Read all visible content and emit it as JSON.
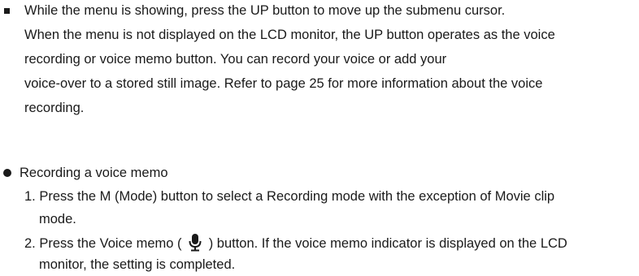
{
  "para1": {
    "line1": "While the menu is showing, press the UP button to move up the submenu cursor.",
    "line2": "When the menu is not displayed on the LCD monitor, the UP button operates as the voice",
    "line3": "recording or voice memo button. You can record your voice or add your",
    "line4": "voice-over to a stored still image. Refer to page 25 for more information about the voice",
    "line5": "recording."
  },
  "section": {
    "heading": "Recording a voice memo",
    "step1_line1": "1. Press the M (Mode) button to select a Recording mode with the exception of Movie clip",
    "step1_line2": "mode.",
    "step2_before_icon": "2. Press the Voice memo (",
    "step2_icon": "microphone-icon",
    "step2_after_icon": ") button. If the voice memo indicator is displayed on the LCD",
    "step2_line2": "monitor, the setting is completed."
  }
}
